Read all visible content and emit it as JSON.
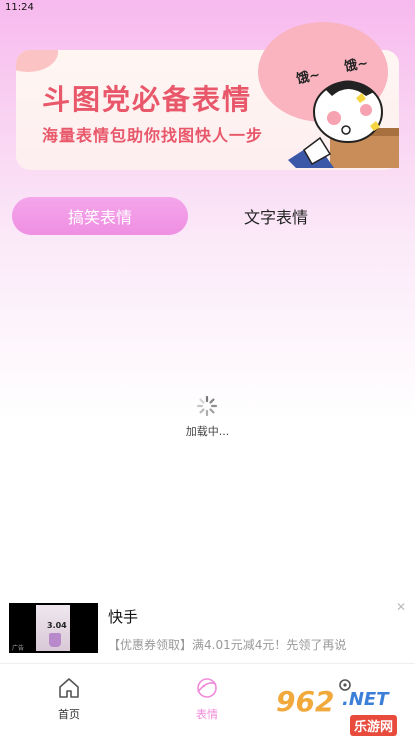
{
  "status_bar": {
    "time": "11:24"
  },
  "banner": {
    "title": "斗图党必备表情",
    "subtitle": "海量表情包助你找图快人一步",
    "art_text_left": "饿~",
    "art_text_right": "饿~"
  },
  "tabs": [
    {
      "label": "搞笑表情",
      "active": true
    },
    {
      "label": "文字表情",
      "active": false
    }
  ],
  "loading": {
    "text": "加载中..."
  },
  "ad": {
    "title": "快手",
    "description": "【优惠券领取】满4.01元减4元！先领了再说",
    "thumb_text": "3.04",
    "thumb_badge": "广告",
    "close_icon": "close-icon"
  },
  "bottom_nav": {
    "items": [
      {
        "label": "首页",
        "icon": "home-icon"
      },
      {
        "label": "表情",
        "icon": "planet-icon",
        "active": true
      },
      {
        "label": "",
        "icon": "user-icon"
      }
    ]
  },
  "watermark": {
    "number": "962",
    "domain": ".NET",
    "sub": "乐游网"
  },
  "colors": {
    "accent": "#ef8fe2",
    "banner_text": "#e8586a",
    "active_nav": "#f08bd9"
  }
}
